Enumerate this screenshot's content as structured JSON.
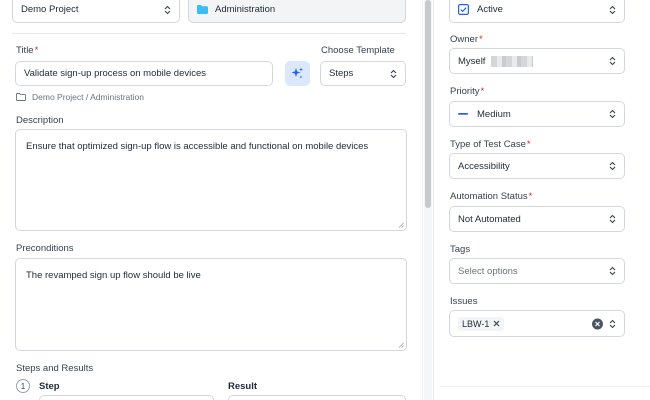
{
  "left": {
    "project_select": "Demo Project",
    "folder_select": "Administration",
    "title_label": "Title",
    "title_value": "Validate sign-up process on mobile devices",
    "template_label": "Choose Template",
    "template_value": "Steps",
    "breadcrumb": "Demo Project / Administration",
    "description_label": "Description",
    "description_value": "Ensure that optimized sign-up flow is accessible and functional on mobile devices",
    "preconditions_label": "Preconditions",
    "preconditions_value": "The revamped sign up flow should be live",
    "steps_label": "Steps and Results",
    "step_number": "1",
    "step_header": "Step",
    "result_header": "Result"
  },
  "right": {
    "status_value": "Active",
    "owner_label": "Owner",
    "owner_value": "Myself",
    "priority_label": "Priority",
    "priority_value": "Medium",
    "type_label": "Type of Test Case",
    "type_value": "Accessibility",
    "automation_label": "Automation Status",
    "automation_value": "Not Automated",
    "tags_label": "Tags",
    "tags_placeholder": "Select options",
    "issues_label": "Issues",
    "issue_chip": "LBW-1"
  },
  "required_mark": "*",
  "colors": {
    "accent_blue": "#2563eb",
    "folder_icon": "#38bdf8",
    "ai_button_bg": "#dbe7fb",
    "required": "#dc2626"
  },
  "icons": {
    "status": "checkbox-check-icon",
    "folder": "folder-icon",
    "ai": "sparkle-icon",
    "priority": "dash-icon",
    "clear": "clear-circle-icon",
    "chevrons": "chevron-updown-icon"
  }
}
